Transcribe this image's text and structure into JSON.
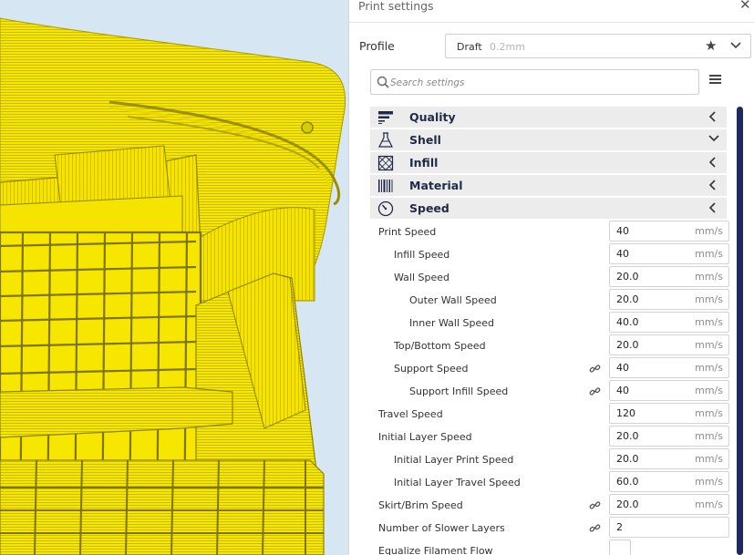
{
  "panel": {
    "title": "Print settings",
    "close_icon": "close-icon",
    "profile_label": "Profile",
    "profile_name": "Draft",
    "profile_layer": "0.2mm",
    "search_placeholder": "Search settings"
  },
  "categories": [
    {
      "label": "Quality",
      "icon": "quality-icon",
      "chevron": "left"
    },
    {
      "label": "Shell",
      "icon": "shell-icon",
      "chevron": "down"
    },
    {
      "label": "Infill",
      "icon": "infill-icon",
      "chevron": "left"
    },
    {
      "label": "Material",
      "icon": "material-icon",
      "chevron": "left"
    },
    {
      "label": "Speed",
      "icon": "speed-icon",
      "chevron": "left"
    }
  ],
  "speed_settings": [
    {
      "label": "Print Speed",
      "value": "40",
      "unit": "mm/s",
      "linked": false
    },
    {
      "label": "Infill Speed",
      "value": "40",
      "unit": "mm/s",
      "linked": false
    },
    {
      "label": "Wall Speed",
      "value": "20.0",
      "unit": "mm/s",
      "linked": false
    },
    {
      "label": "Outer Wall Speed",
      "value": "20.0",
      "unit": "mm/s",
      "linked": false
    },
    {
      "label": "Inner Wall Speed",
      "value": "40.0",
      "unit": "mm/s",
      "linked": false
    },
    {
      "label": "Top/Bottom Speed",
      "value": "20.0",
      "unit": "mm/s",
      "linked": false
    },
    {
      "label": "Support Speed",
      "value": "40",
      "unit": "mm/s",
      "linked": true
    },
    {
      "label": "Support Infill Speed",
      "value": "40",
      "unit": "mm/s",
      "linked": true
    },
    {
      "label": "Travel Speed",
      "value": "120",
      "unit": "mm/s",
      "linked": false
    },
    {
      "label": "Initial Layer Speed",
      "value": "20.0",
      "unit": "mm/s",
      "linked": false
    },
    {
      "label": "Initial Layer Print Speed",
      "value": "20.0",
      "unit": "mm/s",
      "linked": false
    },
    {
      "label": "Initial Layer Travel Speed",
      "value": "60.0",
      "unit": "mm/s",
      "linked": false
    },
    {
      "label": "Skirt/Brim Speed",
      "value": "20.0",
      "unit": "mm/s",
      "linked": true
    },
    {
      "label": "Number of Slower Layers",
      "value": "2",
      "unit": "",
      "linked": true
    },
    {
      "label": "Equalize Filament Flow",
      "value": "",
      "unit": "",
      "linked": false
    }
  ],
  "colors": {
    "model_yellow": "#f5e400",
    "category_header_bg": "#ececec",
    "category_text": "#1f2a46",
    "scrollbar": "#1c2a5d"
  }
}
